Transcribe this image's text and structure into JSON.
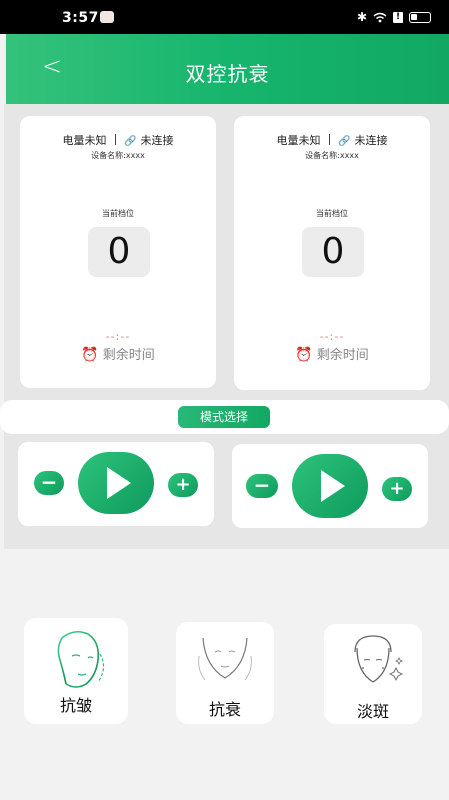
{
  "status_bar": {
    "time": "3:57"
  },
  "header": {
    "title": "双控抗衰",
    "back_symbol": "<"
  },
  "devices": [
    {
      "battery": "电量未知",
      "connection": "未连接",
      "device_name": "设备名称:xxxx",
      "gear_label": "当前档位",
      "gear_value": "0",
      "countdown": "--:--",
      "remaining_label": "剩余时间"
    },
    {
      "battery": "电量未知",
      "connection": "未连接",
      "device_name": "设备名称:xxxx",
      "gear_label": "当前档位",
      "gear_value": "0",
      "countdown": "--:--",
      "remaining_label": "剩余时间"
    }
  ],
  "mode_select_label": "模式选择",
  "controls": {
    "minus": "−",
    "plus": "+"
  },
  "functions": [
    {
      "label": "抗皱",
      "icon": "face-line-icon"
    },
    {
      "label": "抗衰",
      "icon": "face-chin-icon"
    },
    {
      "label": "淡斑",
      "icon": "face-spots-icon"
    }
  ],
  "colors": {
    "accent": "#16b56e",
    "countdown": "#e07a7a"
  }
}
